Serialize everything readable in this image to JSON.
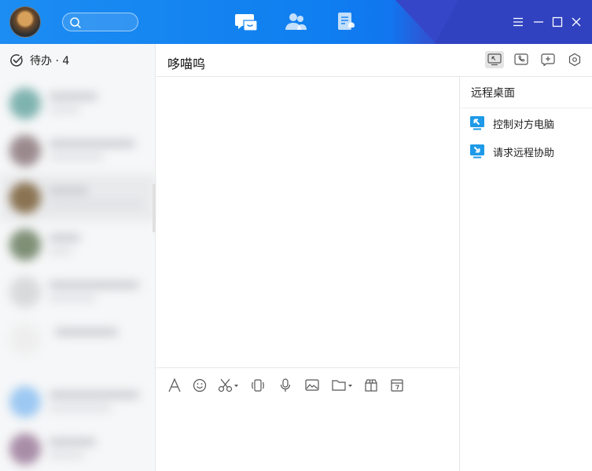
{
  "left": {
    "todo_label": "待办 · 4"
  },
  "chat": {
    "title": "哆喵呜"
  },
  "remote_panel": {
    "title": "远程桌面",
    "items": [
      {
        "label": "控制对方电脑",
        "icon": "remote-control-icon"
      },
      {
        "label": "请求远程协助",
        "icon": "remote-assist-icon"
      }
    ]
  },
  "colors": {
    "brand_blue": "#1c8df2",
    "icon_blue": "#1e9ae8"
  }
}
